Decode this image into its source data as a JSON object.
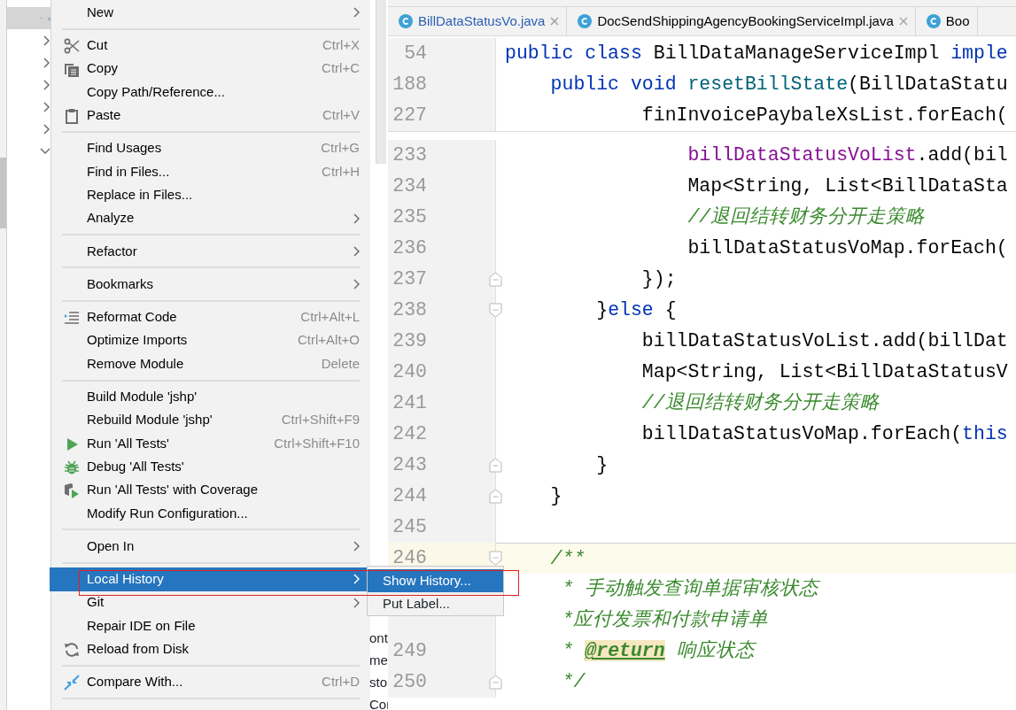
{
  "project_tree": {
    "items": [
      {
        "kind": "folder",
        "expanded": true,
        "selected": true
      },
      {
        "kind": "item",
        "expanded": false,
        "selected": false
      },
      {
        "kind": "item",
        "expanded": false,
        "selected": false
      },
      {
        "kind": "item",
        "expanded": false,
        "selected": false
      },
      {
        "kind": "item",
        "expanded": false,
        "selected": false
      },
      {
        "kind": "item",
        "expanded": false,
        "selected": false
      },
      {
        "kind": "item",
        "expanded": true,
        "selected": false
      }
    ],
    "fragments": [
      "ont",
      "me",
      "sto",
      "Cor"
    ]
  },
  "context_menu": {
    "items": [
      {
        "kind": "item",
        "label": "New",
        "submenu": true,
        "selected": false
      },
      {
        "kind": "separator"
      },
      {
        "kind": "item",
        "label": "Cut",
        "shortcut": "Ctrl+X",
        "selected": false
      },
      {
        "kind": "item",
        "label": "Copy",
        "shortcut": "Ctrl+C",
        "selected": false
      },
      {
        "kind": "item",
        "label": "Copy Path/Reference...",
        "selected": false
      },
      {
        "kind": "item",
        "label": "Paste",
        "shortcut": "Ctrl+V",
        "selected": false
      },
      {
        "kind": "separator"
      },
      {
        "kind": "item",
        "label": "Find Usages",
        "shortcut": "Ctrl+G",
        "selected": false
      },
      {
        "kind": "item",
        "label": "Find in Files...",
        "shortcut": "Ctrl+H",
        "selected": false
      },
      {
        "kind": "item",
        "label": "Replace in Files...",
        "selected": false
      },
      {
        "kind": "item",
        "label": "Analyze",
        "submenu": true,
        "selected": false
      },
      {
        "kind": "separator"
      },
      {
        "kind": "item",
        "label": "Refactor",
        "submenu": true,
        "selected": false
      },
      {
        "kind": "separator"
      },
      {
        "kind": "item",
        "label": "Bookmarks",
        "submenu": true,
        "selected": false
      },
      {
        "kind": "separator"
      },
      {
        "kind": "item",
        "label": "Reformat Code",
        "shortcut": "Ctrl+Alt+L",
        "selected": false
      },
      {
        "kind": "item",
        "label": "Optimize Imports",
        "shortcut": "Ctrl+Alt+O",
        "selected": false
      },
      {
        "kind": "item",
        "label": "Remove Module",
        "shortcut": "Delete",
        "selected": false
      },
      {
        "kind": "separator"
      },
      {
        "kind": "item",
        "label": "Build Module 'jshp'",
        "selected": false
      },
      {
        "kind": "item",
        "label": "Rebuild Module 'jshp'",
        "shortcut": "Ctrl+Shift+F9",
        "selected": false
      },
      {
        "kind": "item",
        "label": "Run 'All Tests'",
        "shortcut": "Ctrl+Shift+F10",
        "selected": false
      },
      {
        "kind": "item",
        "label": "Debug 'All Tests'",
        "selected": false
      },
      {
        "kind": "item",
        "label": "Run 'All Tests' with Coverage",
        "selected": false
      },
      {
        "kind": "item",
        "label": "Modify Run Configuration...",
        "selected": false
      },
      {
        "kind": "separator"
      },
      {
        "kind": "item",
        "label": "Open In",
        "submenu": true,
        "selected": false
      },
      {
        "kind": "separator"
      },
      {
        "kind": "item",
        "label": "Local History",
        "submenu": true,
        "selected": true
      },
      {
        "kind": "item",
        "label": "Git",
        "submenu": true,
        "selected": false
      },
      {
        "kind": "item",
        "label": "Repair IDE on File",
        "selected": false
      },
      {
        "kind": "item",
        "label": "Reload from Disk",
        "selected": false
      },
      {
        "kind": "separator"
      },
      {
        "kind": "item",
        "label": "Compare With...",
        "shortcut": "Ctrl+D",
        "selected": false
      },
      {
        "kind": "separator"
      }
    ]
  },
  "submenu": {
    "items": [
      {
        "label": "Show History...",
        "selected": true
      },
      {
        "label": "Put Label...",
        "selected": false
      }
    ]
  },
  "highlight_box": {
    "shown": true
  },
  "editor": {
    "tabs": [
      {
        "label": "BillDataStatusVo.java",
        "selected": true,
        "closable": true
      },
      {
        "label": "DocSendShippingAgencyBookingServiceImpl.java",
        "selected": false,
        "closable": true
      },
      {
        "label": "Boo",
        "selected": false,
        "closable": false
      }
    ],
    "sticky_lines": [
      {
        "number": "54",
        "segments": [
          {
            "kind": "keyword",
            "text": "public class "
          },
          {
            "kind": "plain",
            "text": "BillDataManageServiceImpl "
          },
          {
            "kind": "keyword",
            "text": "imple"
          }
        ]
      },
      {
        "number": "188",
        "segments": [
          {
            "kind": "keyword",
            "text": "    public void "
          },
          {
            "kind": "method",
            "text": "resetBillState"
          },
          {
            "kind": "plain",
            "text": "(BillDataStatu"
          }
        ]
      },
      {
        "number": "227",
        "segments": [
          {
            "kind": "plain",
            "text": "            finInvoicePaybaleXsList.forEach("
          }
        ]
      }
    ],
    "lines": [
      {
        "kind": "line",
        "number": "233",
        "current": false,
        "segments": [
          {
            "kind": "field",
            "text": "                billDataStatusVoList"
          },
          {
            "kind": "plain",
            "text": ".add(bil"
          }
        ]
      },
      {
        "kind": "line",
        "number": "234",
        "current": false,
        "segments": [
          {
            "kind": "plain",
            "text": "                Map<String, List<BillDataSta"
          }
        ]
      },
      {
        "kind": "line",
        "number": "235",
        "current": false,
        "segments": [
          {
            "kind": "comment",
            "text": "                //退回结转财务分开走策略"
          }
        ]
      },
      {
        "kind": "line",
        "number": "236",
        "current": false,
        "segments": [
          {
            "kind": "plain",
            "text": "                billDataStatusVoMap.forEach("
          }
        ]
      },
      {
        "kind": "fold-end",
        "number": "237",
        "current": false,
        "segments": [
          {
            "kind": "plain",
            "text": "            });"
          }
        ]
      },
      {
        "kind": "fold-start",
        "number": "238",
        "current": false,
        "segments": [
          {
            "kind": "plain",
            "text": "        }"
          },
          {
            "kind": "keyword",
            "text": "else "
          },
          {
            "kind": "plain",
            "text": "{"
          }
        ]
      },
      {
        "kind": "line",
        "number": "239",
        "current": false,
        "segments": [
          {
            "kind": "plain",
            "text": "            billDataStatusVoList.add(billDat"
          }
        ]
      },
      {
        "kind": "line",
        "number": "240",
        "current": false,
        "segments": [
          {
            "kind": "plain",
            "text": "            Map<String, List<BillDataStatusV"
          }
        ]
      },
      {
        "kind": "line",
        "number": "241",
        "current": false,
        "segments": [
          {
            "kind": "comment",
            "text": "            //退回结转财务分开走策略"
          }
        ]
      },
      {
        "kind": "line",
        "number": "242",
        "current": false,
        "segments": [
          {
            "kind": "plain",
            "text": "            billDataStatusVoMap.forEach("
          },
          {
            "kind": "keyword",
            "text": "this"
          }
        ]
      },
      {
        "kind": "fold-end",
        "number": "243",
        "current": false,
        "segments": [
          {
            "kind": "plain",
            "text": "        }"
          }
        ]
      },
      {
        "kind": "fold-end",
        "number": "244",
        "current": false,
        "segments": [
          {
            "kind": "plain",
            "text": "    }"
          }
        ]
      },
      {
        "kind": "line",
        "number": "245",
        "current": false
      },
      {
        "kind": "fold-start",
        "number": "246",
        "current": true,
        "segments": [
          {
            "kind": "comment",
            "text": "    /**"
          }
        ]
      },
      {
        "kind": "line",
        "current": false,
        "segments": [
          {
            "kind": "comment",
            "text": "     * 手动触发查询单据审核状态"
          }
        ]
      },
      {
        "kind": "line",
        "current": false,
        "segments": [
          {
            "kind": "comment",
            "text": "     *应付发票和付款申请单"
          }
        ]
      },
      {
        "kind": "line",
        "number": "249",
        "current": false,
        "segments": [
          {
            "kind": "comment",
            "text": "     * "
          },
          {
            "kind": "tag",
            "text": "@return"
          },
          {
            "kind": "comment",
            "text": " 响应状态"
          }
        ]
      },
      {
        "kind": "fold-end",
        "number": "250",
        "current": false,
        "segments": [
          {
            "kind": "comment",
            "text": "     */"
          }
        ]
      }
    ]
  }
}
